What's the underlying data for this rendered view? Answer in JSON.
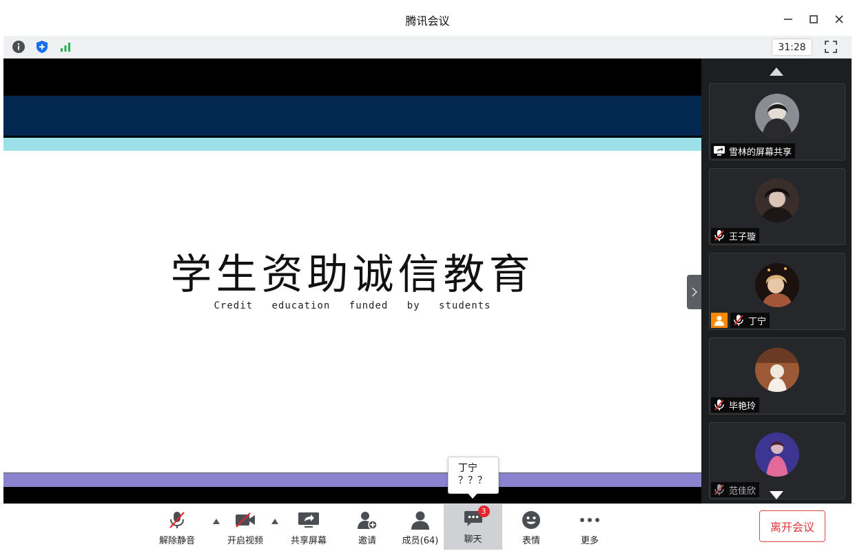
{
  "window": {
    "title": "腾讯会议"
  },
  "infobar": {
    "timer": "31:28"
  },
  "slide": {
    "title": "学生资助诚信教育",
    "subtitle": "Credit education funded by students"
  },
  "participants": [
    {
      "name": "雪林的屏幕共享",
      "status_icon": "screen-share-icon",
      "avatar_color": "#7b7e86"
    },
    {
      "name": "王子璇",
      "status_icon": "mic-muted-icon",
      "avatar_color": "#4a3b36"
    },
    {
      "name": "丁宁",
      "status_icon": "mic-muted-icon",
      "avatar_color": "#6b4a2f",
      "host": true
    },
    {
      "name": "毕艳玲",
      "status_icon": "mic-muted-icon",
      "avatar_color": "#8b5a3c"
    },
    {
      "name": "范佳欣",
      "status_icon": "mic-muted-icon",
      "avatar_color": "#4a3f9a"
    }
  ],
  "toolbar": {
    "unmute": "解除静音",
    "video": "开启视频",
    "share": "共享屏幕",
    "invite": "邀请",
    "members": "成员(64)",
    "chat": "聊天",
    "chat_badge": "3",
    "emoji": "表情",
    "more": "更多",
    "leave": "离开会议"
  },
  "chat_popup": {
    "sender": "丁宁",
    "message": "？？？"
  },
  "colors": {
    "navy_band": "#022850",
    "cyan_band": "#9ee0ea",
    "purple_band": "#8b83cf",
    "leave_red": "#e0333a",
    "badge_red": "#e5242b",
    "host_orange": "#ff8a00"
  }
}
